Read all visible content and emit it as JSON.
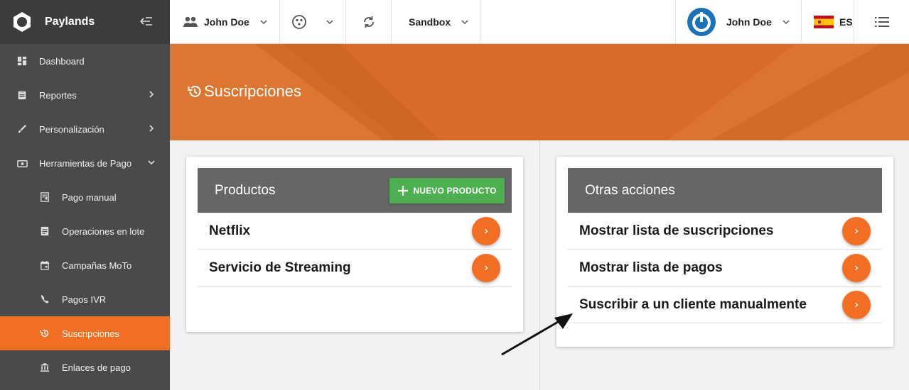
{
  "sidebar": {
    "brand": "Paylands",
    "items": [
      {
        "label": "Dashboard",
        "icon": "dashboard-icon"
      },
      {
        "label": "Reportes",
        "icon": "report-icon"
      },
      {
        "label": "Personalización",
        "icon": "brush-icon"
      },
      {
        "label": "Herramientas de Pago",
        "icon": "payment-tools-icon"
      },
      {
        "label": "Pago manual",
        "icon": "manual-payment-icon"
      },
      {
        "label": "Operaciones en lote",
        "icon": "batch-icon"
      },
      {
        "label": "Campañas MoTo",
        "icon": "calendar-icon"
      },
      {
        "label": "Pagos IVR",
        "icon": "phone-icon"
      },
      {
        "label": "Suscripciones",
        "icon": "history-icon"
      },
      {
        "label": "Enlaces de pago",
        "icon": "bank-icon"
      }
    ]
  },
  "topbar": {
    "user": "John Doe",
    "environment": "Sandbox",
    "profile_name": "John Doe",
    "language": "ES"
  },
  "banner": {
    "title": "Suscripciones"
  },
  "products": {
    "title": "Productos",
    "new_button": "NUEVO PRODUCTO",
    "items": [
      "Netflix",
      "Servicio de Streaming"
    ]
  },
  "actions": {
    "title": "Otras acciones",
    "items": [
      "Mostrar lista de suscripciones",
      "Mostrar lista de pagos",
      "Suscribir a un cliente manualmente"
    ]
  },
  "colors": {
    "accent": "#f26e22",
    "sidebar": "#4a4a4a",
    "banner": "#d86b2a",
    "success": "#4caf50"
  }
}
